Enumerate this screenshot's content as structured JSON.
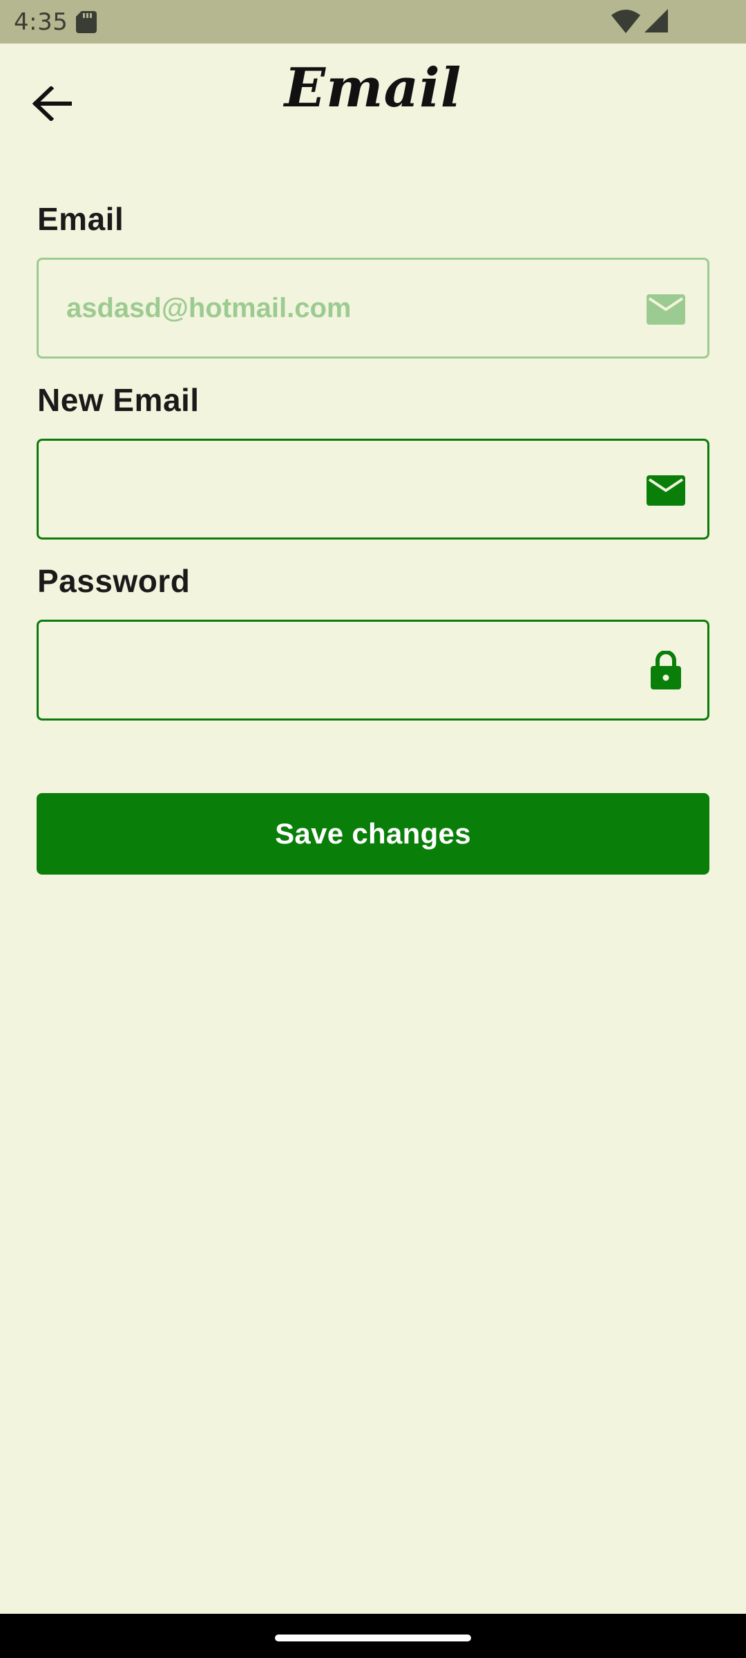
{
  "status_bar": {
    "time": "4:35",
    "icons": [
      "sd-card-icon",
      "wifi-icon",
      "cell-signal-icon"
    ]
  },
  "header": {
    "title": "Email",
    "back_icon": "arrow-left-icon"
  },
  "form": {
    "email_label": "Email",
    "email_value": "asdasd@hotmail.com",
    "email_icon": "envelope-icon",
    "new_email_label": "New Email",
    "new_email_value": "",
    "new_email_icon": "envelope-icon",
    "password_label": "Password",
    "password_value": "",
    "password_icon": "lock-icon"
  },
  "actions": {
    "save_label": "Save changes"
  },
  "colors": {
    "background": "#f3f4dd",
    "status_bar": "#b4b78f",
    "accent_green": "#097e09",
    "disabled_green": "#9ccb92",
    "nav_bar": "#000000"
  }
}
